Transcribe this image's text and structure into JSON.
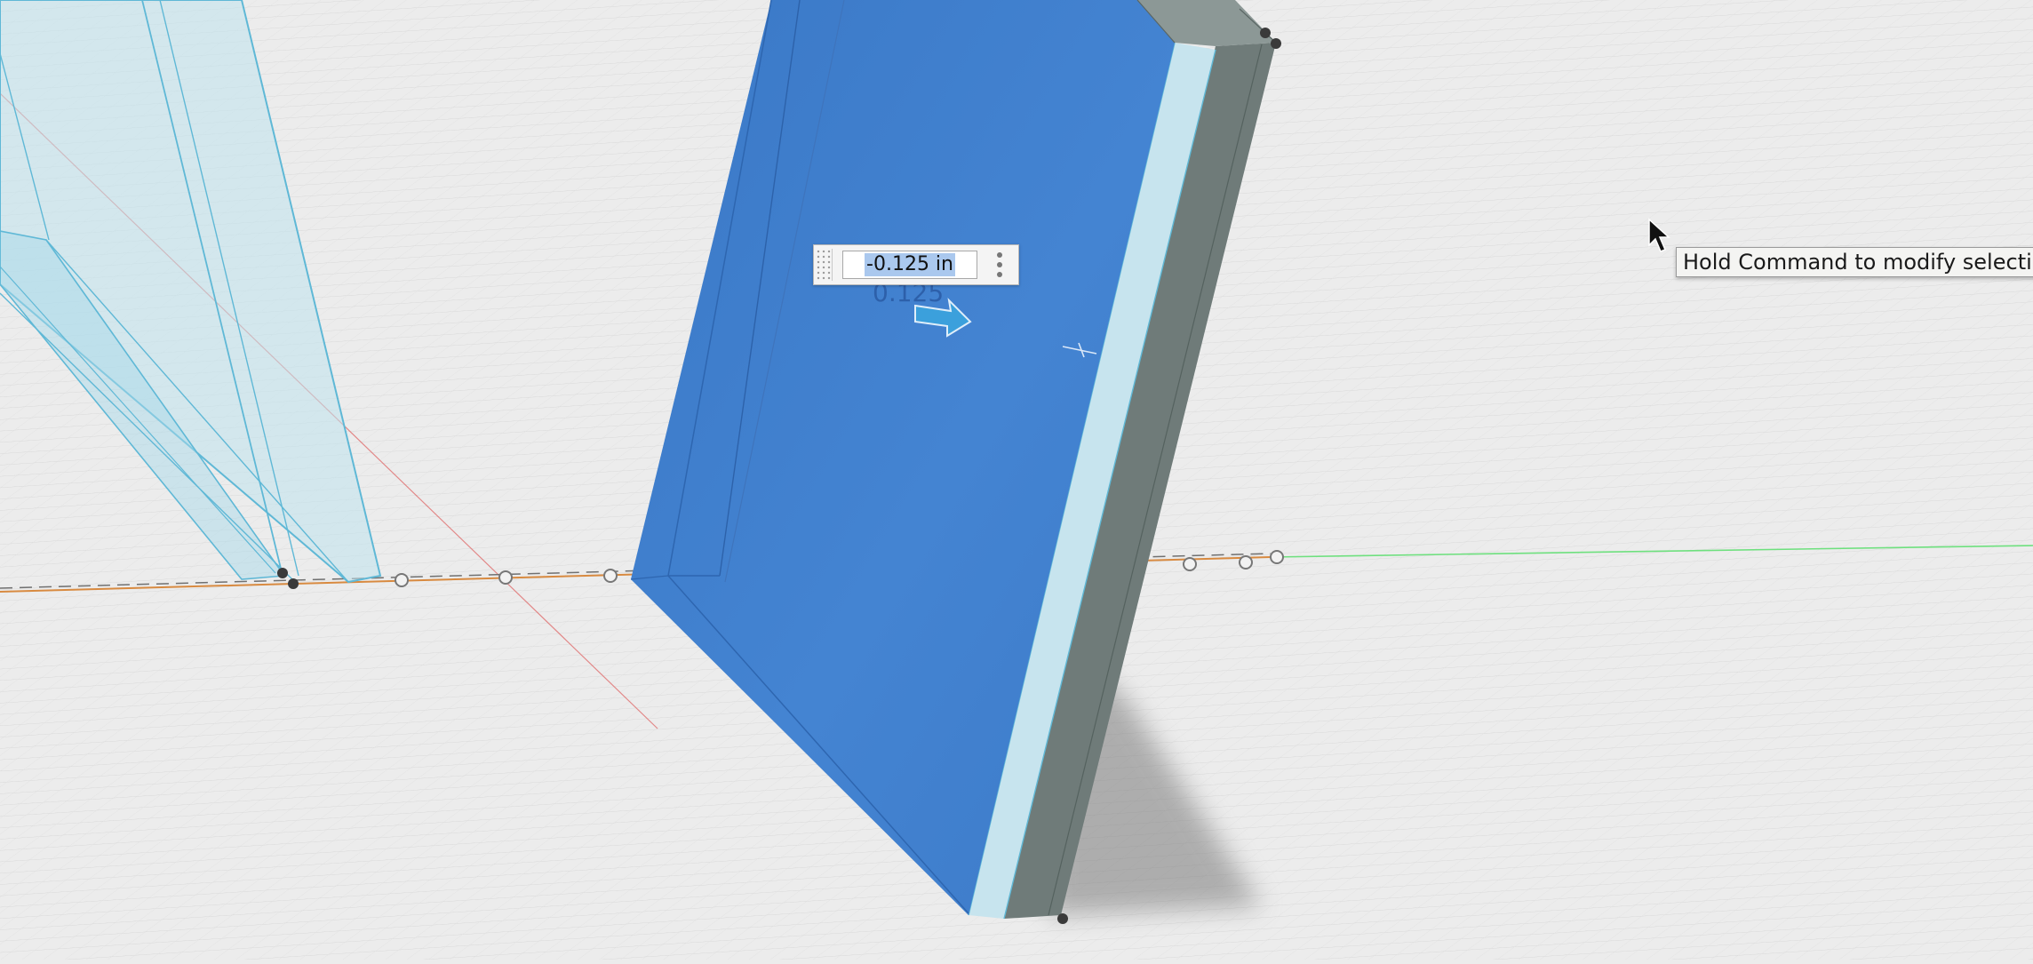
{
  "dimension_input": {
    "value": "-0.125 in",
    "ghost_value": "0.125"
  },
  "tooltip": {
    "text": "Hold Command to modify selection"
  },
  "colors": {
    "canvas_background": "#ececec",
    "selected_face": "#3f7fcc",
    "transparent_body": "#bfe3ef",
    "body_edge": "#5fb8d6",
    "side_face": "#6e7a78",
    "x_axis": "#e07f3a",
    "y_axis": "#5ee07a",
    "z_axis": "#e06060"
  },
  "icons": [
    "arrow-cursor-icon",
    "drag-arrow-icon",
    "overflow-menu-icon",
    "grip-icon"
  ]
}
